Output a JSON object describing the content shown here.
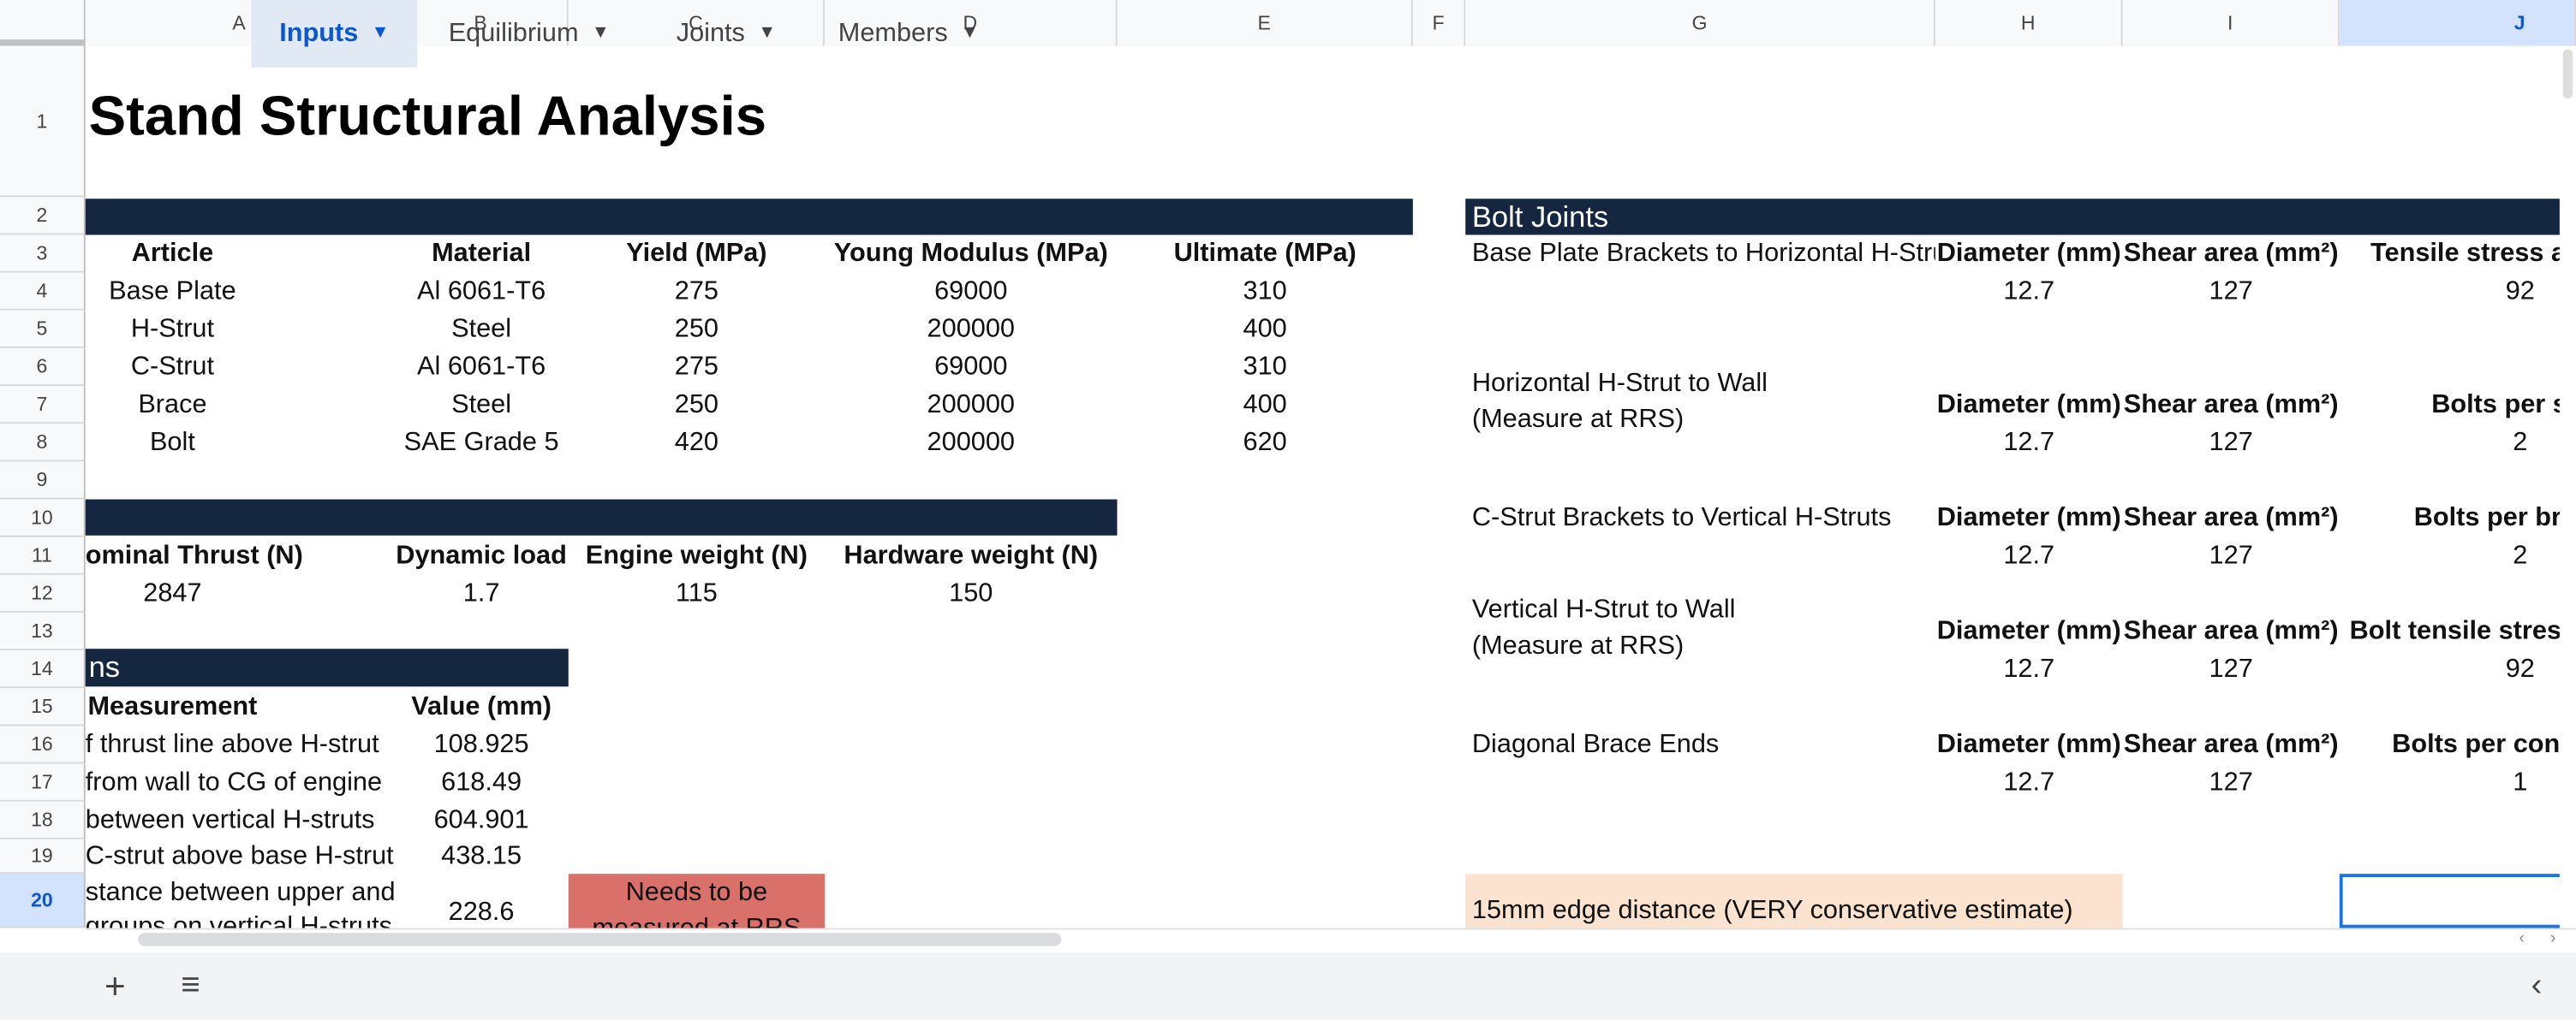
{
  "columns": [
    "A",
    "B",
    "C",
    "D",
    "E",
    "F",
    "G",
    "H",
    "I",
    "J"
  ],
  "rows": [
    "1",
    "2",
    "3",
    "4",
    "5",
    "6",
    "7",
    "8",
    "9",
    "10",
    "11",
    "12",
    "13",
    "14",
    "15",
    "16",
    "17",
    "18",
    "19",
    "20"
  ],
  "title": "Stand Structural Analysis",
  "materials": {
    "headers": [
      "Article",
      "Material",
      "Yield (MPa)",
      "Young Modulus (MPa)",
      "Ultimate (MPa)"
    ],
    "rows": [
      [
        "Base Plate",
        "Al 6061-T6",
        "275",
        "69000",
        "310"
      ],
      [
        "H-Strut",
        "Steel",
        "250",
        "200000",
        "400"
      ],
      [
        "C-Strut",
        "Al 6061-T6",
        "275",
        "69000",
        "310"
      ],
      [
        "Brace",
        "Steel",
        "250",
        "200000",
        "400"
      ],
      [
        "Bolt",
        "SAE Grade 5",
        "420",
        "200000",
        "620"
      ]
    ]
  },
  "loads": {
    "headers": [
      "ominal Thrust (N)",
      "Dynamic load",
      "Engine weight (N)",
      "Hardware weight (N)"
    ],
    "values": [
      "2847",
      "1.7",
      "115",
      "150"
    ]
  },
  "dimensions": {
    "band_label": "ns",
    "headers": [
      "Measurement",
      "Value (mm)"
    ],
    "rows": [
      [
        "f thrust line above H-strut",
        "108.925"
      ],
      [
        "from wall to CG of engine",
        "618.49"
      ],
      [
        "between vertical H-struts",
        "604.901"
      ],
      [
        "C-strut above base H-struts",
        "438.15"
      ],
      [
        "stance between upper and\ngroups on vertical H-struts",
        "228.6"
      ]
    ],
    "note": "Needs to be\nmeasured at RRS"
  },
  "bolt_joints": {
    "band_label": "Bolt Joints",
    "groups": [
      {
        "name": "Base Plate Brackets to Horizontal H-Strut",
        "h_head": "Diameter (mm)",
        "i_head": "Shear area (mm²)",
        "j_head": "Tensile stress ar",
        "h": "12.7",
        "i": "127",
        "j": "92"
      },
      {
        "name": "Horizontal H-Strut to Wall\n(Measure at RRS)",
        "h_head": "Diameter (mm)",
        "i_head": "Shear area (mm²)",
        "j_head": "Bolts per st",
        "h": "12.7",
        "i": "127",
        "j": "2"
      },
      {
        "name": "C-Strut Brackets to Vertical H-Struts",
        "h_head": "Diameter (mm)",
        "i_head": "Shear area (mm²)",
        "j_head": "Bolts per bra",
        "h": "12.7",
        "i": "127",
        "j": "2"
      },
      {
        "name": "Vertical H-Strut to Wall\n(Measure at RRS)",
        "h_head": "Diameter (mm)",
        "i_head": "Shear area (mm²)",
        "j_head": "Bolt tensile stress",
        "h": "12.7",
        "i": "127",
        "j": "92"
      },
      {
        "name": "Diagonal Brace Ends",
        "h_head": "Diameter (mm)",
        "i_head": "Shear area (mm²)",
        "j_head": "Bolts per conn",
        "h": "12.7",
        "i": "127",
        "j": "1"
      }
    ],
    "edge_note": "15mm edge distance (VERY conservative estimate)"
  },
  "tabs": [
    {
      "label": "Inputs"
    },
    {
      "label": "Equilibrium"
    },
    {
      "label": "Joints"
    },
    {
      "label": "Members"
    }
  ],
  "colors": {
    "band": "#142640",
    "red": "#d9706a",
    "peach": "#fbe3cf",
    "accent": "#0b57d0"
  }
}
